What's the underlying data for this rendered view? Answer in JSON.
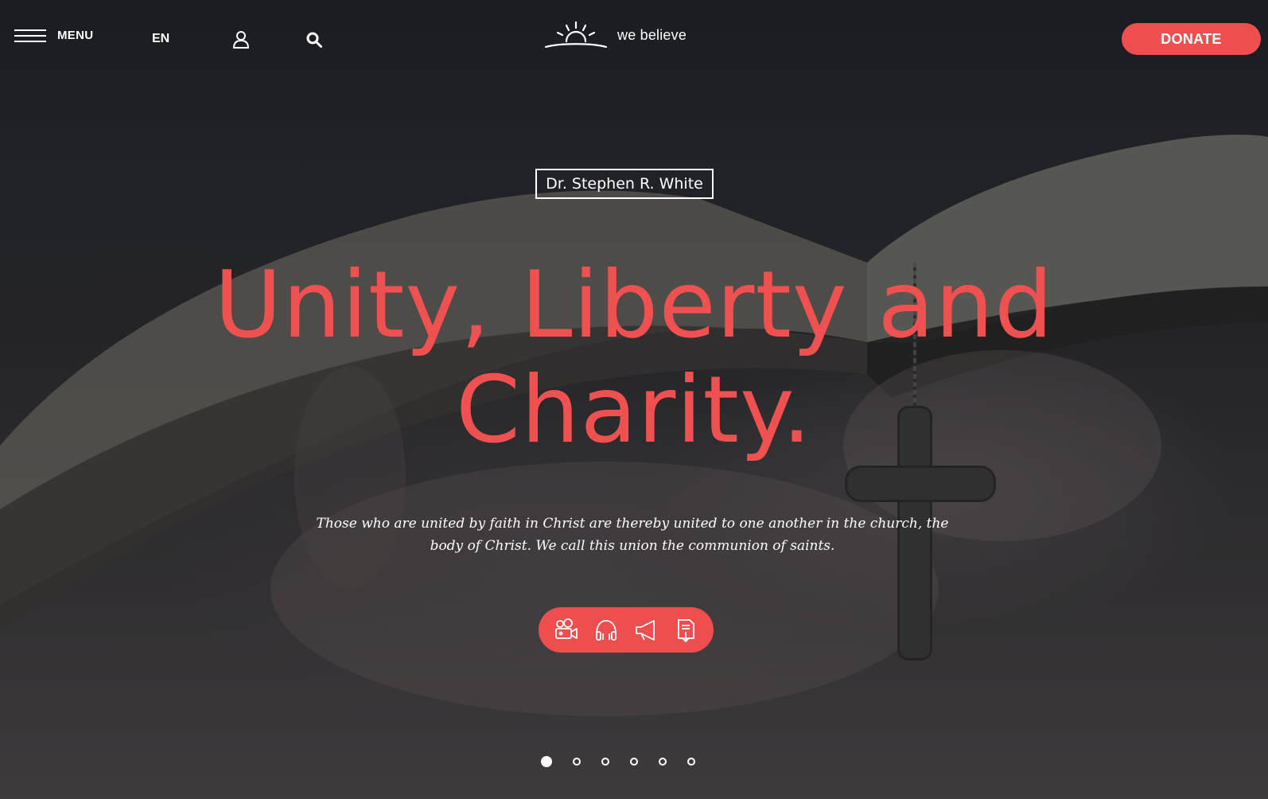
{
  "header": {
    "menu_label": "MENU",
    "language": "EN",
    "logo_text": "we believe",
    "donate_label": "DONATE",
    "icons": [
      "hamburger-icon",
      "user-icon",
      "search-icon",
      "sunrise-logo-icon"
    ]
  },
  "hero": {
    "author": "Dr. Stephen R. White",
    "headline_line1": "Unity, Liberty and",
    "headline_line2": "Charity.",
    "quote": "Those who are united by faith in Christ are thereby united to one another in the church, the body of Christ. We call this union the communion of saints.",
    "media_icons": [
      "video-camera-icon",
      "headphones-icon",
      "megaphone-icon",
      "document-download-icon"
    ]
  },
  "slider": {
    "total": 6,
    "active_index": 0
  },
  "colors": {
    "accent": "#ee4f4e",
    "headline": "#ef5150",
    "text": "#ffffff"
  }
}
